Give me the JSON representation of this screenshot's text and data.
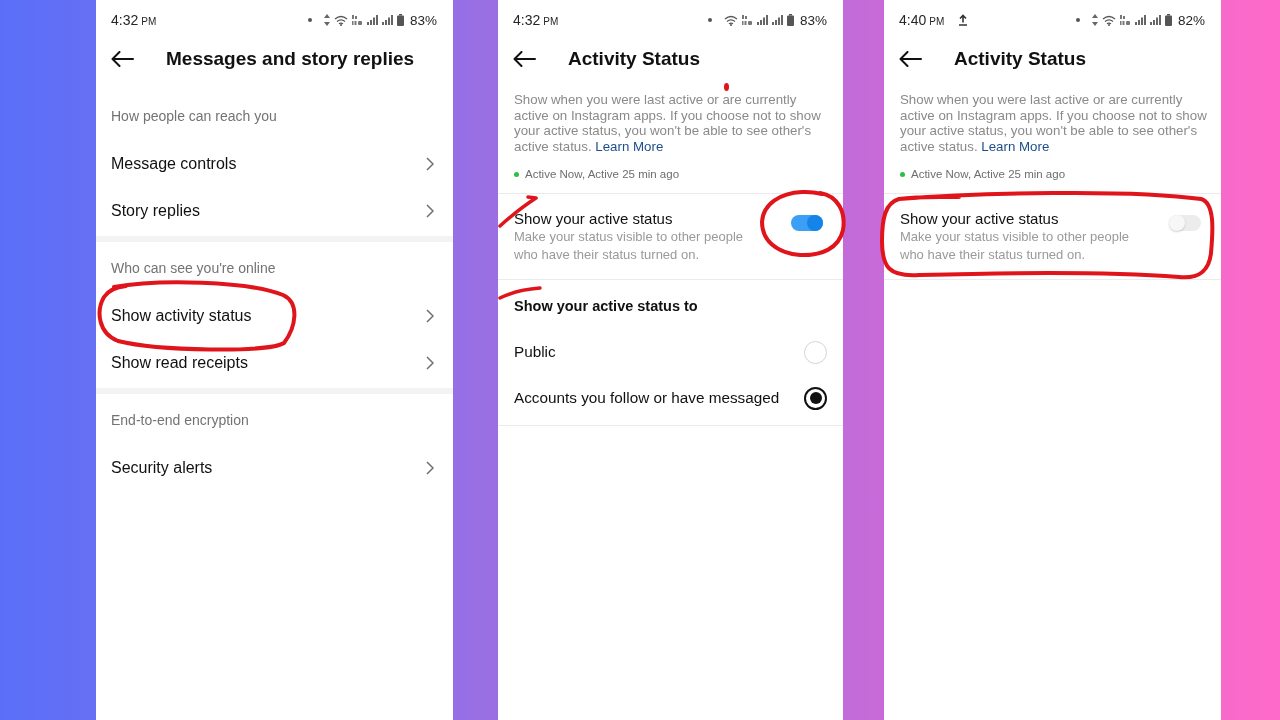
{
  "screens": [
    {
      "kind": "menu",
      "status_bar": {
        "time": "4:32",
        "meridiem": "PM",
        "upload": false,
        "data_active": true,
        "battery": "83%"
      },
      "title": "Messages and story replies",
      "sections": [
        {
          "label": "How people can reach you",
          "items": [
            {
              "label": "Message controls",
              "circled": false
            },
            {
              "label": "Story replies",
              "circled": false
            }
          ]
        },
        {
          "label": "Who can see you're online",
          "items": [
            {
              "label": "Show activity status",
              "circled": true
            },
            {
              "label": "Show read receipts",
              "circled": false
            }
          ]
        },
        {
          "label": "End-to-end encryption",
          "items": [
            {
              "label": "Security alerts",
              "circled": false
            }
          ]
        }
      ]
    },
    {
      "kind": "activity",
      "status_bar": {
        "time": "4:32",
        "meridiem": "PM",
        "upload": false,
        "data_active": false,
        "battery": "83%"
      },
      "title": "Activity Status",
      "description": {
        "text": "Show when you were last active or are currently active on Instagram apps. If you choose not to show your active status, you won't be able to see other's active status.",
        "link": "Learn More",
        "marked": true
      },
      "presence": "Active Now, Active 25 min ago",
      "toggle_row": {
        "title": "Show your active status",
        "subtitle": "Make your status visible to other people who have their status turned on.",
        "on": true,
        "switch_circled": true,
        "row_circled": false,
        "marked": true
      },
      "audience": {
        "heading": "Show your active status to",
        "marked": true,
        "options": [
          {
            "label": "Public",
            "selected": false
          },
          {
            "label": "Accounts you follow or have messaged",
            "selected": true
          }
        ]
      }
    },
    {
      "kind": "activity",
      "status_bar": {
        "time": "4:40",
        "meridiem": "PM",
        "upload": true,
        "data_active": true,
        "battery": "82%"
      },
      "title": "Activity Status",
      "description": {
        "text": "Show when you were last active or are currently active on Instagram apps. If you choose not to show your active status, you won't be able to see other's active status.",
        "link": "Learn More",
        "marked": false
      },
      "presence": "Active Now, Active 25 min ago",
      "toggle_row": {
        "title": "Show your active status",
        "subtitle": "Make your status visible to other people who have their status turned on.",
        "on": false,
        "switch_circled": false,
        "row_circled": true,
        "marked": false
      }
    }
  ]
}
